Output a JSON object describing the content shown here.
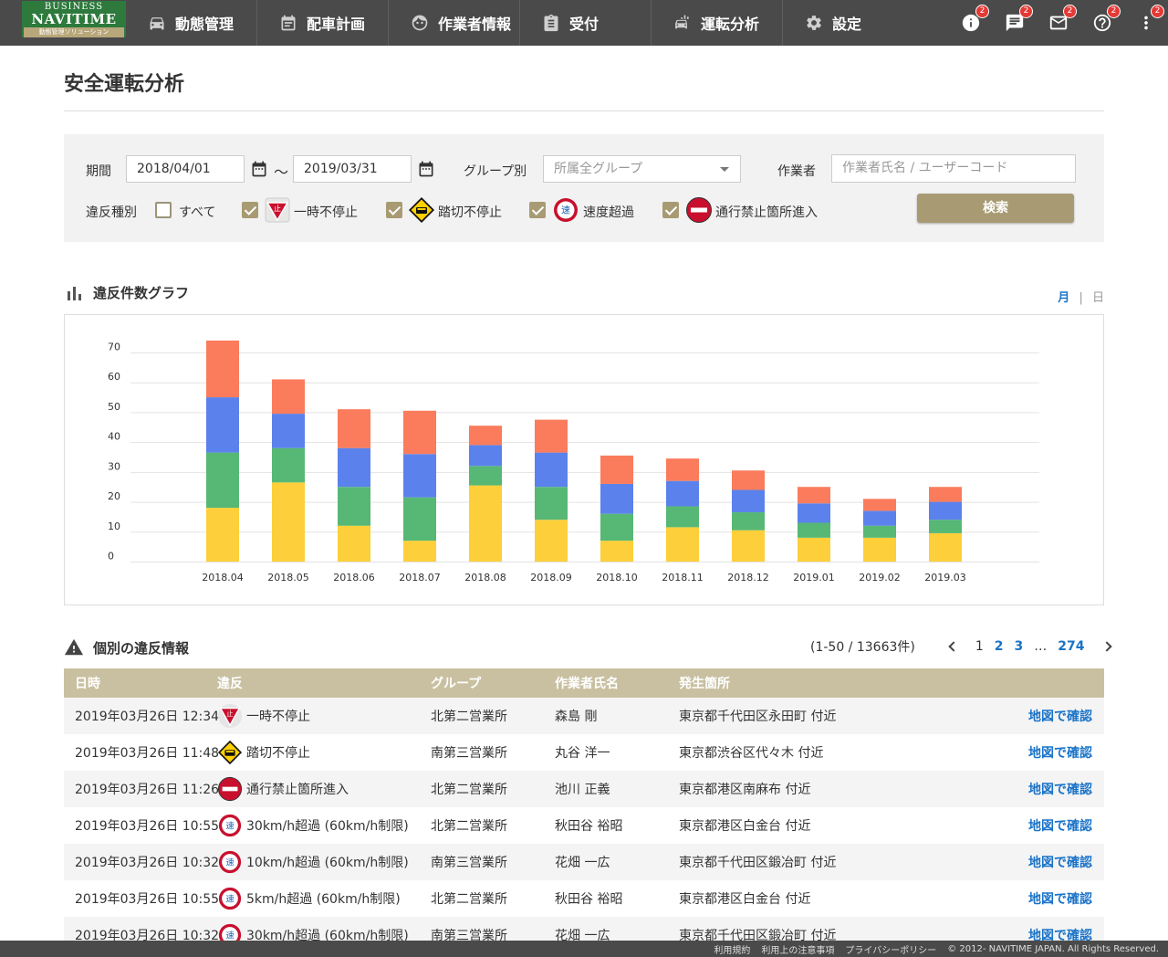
{
  "logo": {
    "line1": "BUSINESS",
    "line2": "NAVITIME",
    "line3": "動態管理ソリューション"
  },
  "nav": [
    {
      "label": "動態管理",
      "icon": "car-icon"
    },
    {
      "label": "配車計画",
      "icon": "calendar-icon"
    },
    {
      "label": "作業者情報",
      "icon": "face-icon"
    },
    {
      "label": "受付",
      "icon": "clipboard-icon"
    },
    {
      "label": "運転分析",
      "icon": "car-analysis-icon"
    },
    {
      "label": "設定",
      "icon": "gear-icon"
    }
  ],
  "nav_right": [
    {
      "icon": "info-icon",
      "badge": "2"
    },
    {
      "icon": "chat-icon",
      "badge": "2"
    },
    {
      "icon": "mail-icon",
      "badge": "2"
    },
    {
      "icon": "help-icon",
      "badge": "2"
    },
    {
      "icon": "more-vert-icon",
      "badge": "2"
    }
  ],
  "page_title": "安全運転分析",
  "search": {
    "period_label": "期間",
    "date_from": "2018/04/01",
    "tilde": "〜",
    "date_to": "2019/03/31",
    "group_label": "グループ別",
    "group_placeholder": "所属全グループ",
    "worker_label": "作業者",
    "worker_placeholder": "作業者氏名 / ユーザーコード",
    "violation_label": "違反種別",
    "options": [
      {
        "label": "すべて",
        "checked": false
      },
      {
        "label": "一時不停止",
        "checked": true,
        "icon": "stop-sign-icon"
      },
      {
        "label": "踏切不停止",
        "checked": true,
        "icon": "railroad-crossing-icon"
      },
      {
        "label": "速度超過",
        "checked": true,
        "icon": "speed-sign-icon"
      },
      {
        "label": "通行禁止箇所進入",
        "checked": true,
        "icon": "no-entry-icon"
      }
    ],
    "search_button": "検索"
  },
  "graph_section": {
    "title": "違反件数グラフ",
    "toggle_month": "月",
    "sep": "|",
    "toggle_day": "日"
  },
  "colors": {
    "yellow": "#fdcf3a",
    "green": "#56b874",
    "blue": "#5b82ec",
    "red": "#fa7c5c"
  },
  "chart_data": {
    "type": "bar",
    "stacked": true,
    "categories": [
      "2018.04",
      "2018.05",
      "2018.06",
      "2018.07",
      "2018.08",
      "2018.09",
      "2018.10",
      "2018.11",
      "2018.12",
      "2019.01",
      "2019.02",
      "2019.03"
    ],
    "series": [
      {
        "color": "#fdcf3a",
        "values": [
          18,
          26.5,
          12,
          7,
          25.5,
          14,
          7,
          11.5,
          10.5,
          8,
          8,
          9.5
        ]
      },
      {
        "color": "#56b874",
        "values": [
          18.5,
          11.5,
          13,
          14.5,
          6.5,
          11,
          9,
          7,
          6,
          5,
          4,
          4.5
        ]
      },
      {
        "color": "#5b82ec",
        "values": [
          18.5,
          11.5,
          13,
          14.5,
          7,
          11.5,
          10,
          8.5,
          7.5,
          6.5,
          5,
          6
        ]
      },
      {
        "color": "#fa7c5c",
        "values": [
          19,
          11.5,
          13,
          14.5,
          6.5,
          11,
          9.5,
          7.5,
          6.5,
          5.5,
          4,
          5
        ]
      }
    ],
    "yticks": [
      0,
      10,
      20,
      30,
      40,
      50,
      60,
      70
    ],
    "ylim": [
      0,
      70
    ],
    "grid": true
  },
  "list_section": {
    "title": "個別の違反情報",
    "count": "(1-50 / 13663件)",
    "pages": [
      "1",
      "2",
      "3",
      "…",
      "274"
    ],
    "columns": [
      "日時",
      "違反",
      "グループ",
      "作業者氏名",
      "発生箇所"
    ],
    "map_link": "地図で確認",
    "rows": [
      {
        "date": "2019年03月26日  12:34",
        "icon": "stop-sign-icon",
        "violation": "一時不停止",
        "group": "北第二営業所",
        "worker": "森島 剛",
        "place": "東京都千代田区永田町 付近"
      },
      {
        "date": "2019年03月26日  11:48",
        "icon": "railroad-crossing-icon",
        "violation": "踏切不停止",
        "group": "南第三営業所",
        "worker": "丸谷 洋一",
        "place": "東京都渋谷区代々木 付近"
      },
      {
        "date": "2019年03月26日  11:26",
        "icon": "no-entry-icon",
        "violation": "通行禁止箇所進入",
        "group": "北第二営業所",
        "worker": "池川 正義",
        "place": "東京都港区南麻布 付近"
      },
      {
        "date": "2019年03月26日  10:55",
        "icon": "speed-sign-icon",
        "violation": "30km/h超過 (60km/h制限)",
        "group": "北第二営業所",
        "worker": "秋田谷 裕昭",
        "place": "東京都港区白金台 付近"
      },
      {
        "date": "2019年03月26日  10:32",
        "icon": "speed-sign-icon",
        "violation": "10km/h超過 (60km/h制限)",
        "group": "南第三営業所",
        "worker": "花畑 一広",
        "place": "東京都千代田区鍛冶町 付近"
      },
      {
        "date": "2019年03月26日  10:55",
        "icon": "speed-sign-icon",
        "violation": "5km/h超過 (60km/h制限)",
        "group": "北第二営業所",
        "worker": "秋田谷 裕昭",
        "place": "東京都港区白金台 付近"
      },
      {
        "date": "2019年03月26日  10:32",
        "icon": "speed-sign-icon",
        "violation": "30km/h超過 (60km/h制限)",
        "group": "南第三営業所",
        "worker": "花畑 一広",
        "place": "東京都千代田区鍛冶町 付近"
      }
    ]
  },
  "footer": {
    "links": [
      "利用規約",
      "利用上の注意事項",
      "プライバシーポリシー"
    ],
    "copyright": "© 2012- NAVITIME JAPAN. All Rights Reserved."
  }
}
